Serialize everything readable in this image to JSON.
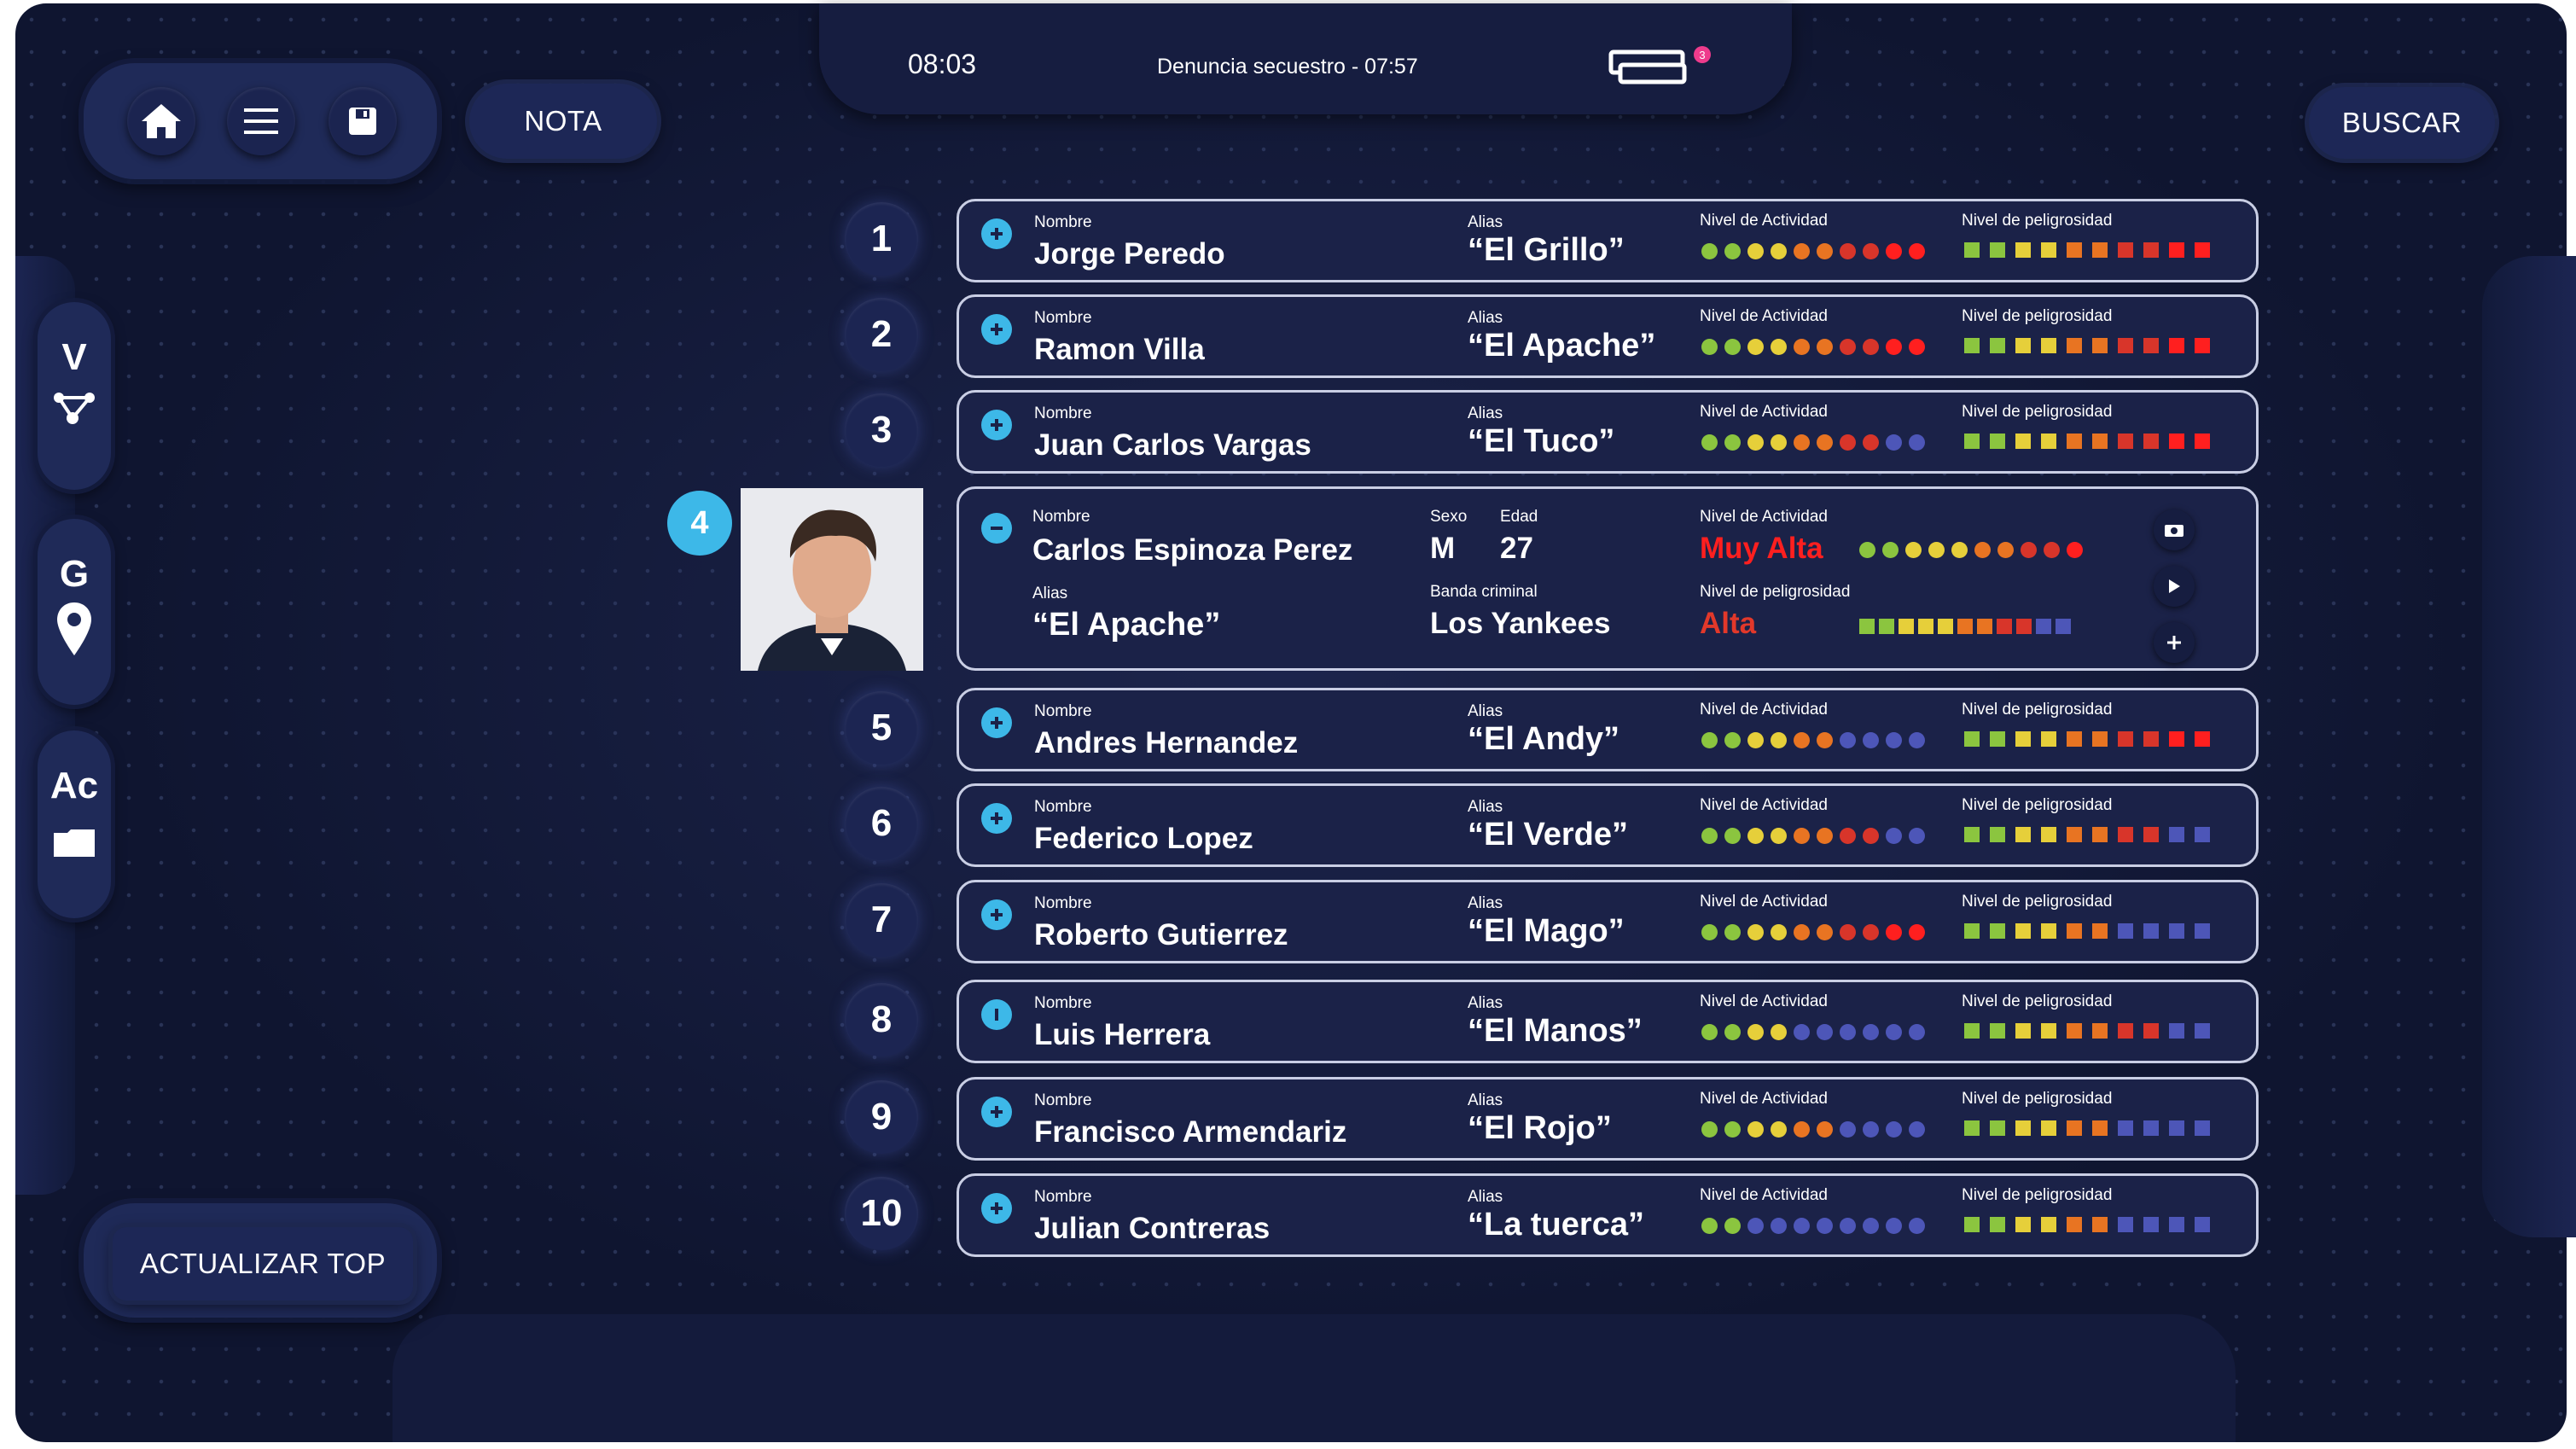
{
  "top": {
    "time": "08:03",
    "title": "Denuncia secuestro  -  07:57",
    "notifications": "3"
  },
  "toolbar": {
    "nota": "NOTA",
    "buscar": "BUSCAR",
    "actualizar": "ACTUALIZAR TOP"
  },
  "sidebar": [
    {
      "letter": "V",
      "icon": "network-icon"
    },
    {
      "letter": "G",
      "icon": "location-pin-icon"
    },
    {
      "letter": "Ac",
      "icon": "folder-icon"
    }
  ],
  "labels": {
    "nombre": "Nombre",
    "alias": "Alias",
    "actividad": "Nivel de Actividad",
    "peligrosidad": "Nivel de peligrosidad",
    "sexo": "Sexo",
    "edad": "Edad",
    "banda": "Banda criminal"
  },
  "colors": {
    "green": "#8bc53f",
    "yellow": "#e6cf3a",
    "orange": "#e87422",
    "red": "#d8352a",
    "brightred": "#ff1f1f",
    "blue": "#4d56b8",
    "accent": "#3db8e8"
  },
  "rows": [
    {
      "rank": "1",
      "name": "Jorge Peredo",
      "alias": "“El Grillo”",
      "activity": [
        "green",
        "green",
        "yellow",
        "yellow",
        "orange",
        "orange",
        "red",
        "red",
        "brightred",
        "brightred"
      ],
      "danger": [
        "green",
        "green",
        "yellow",
        "yellow",
        "orange",
        "orange",
        "red",
        "red",
        "brightred",
        "brightred"
      ]
    },
    {
      "rank": "2",
      "name": "Ramon Villa",
      "alias": "“El Apache”",
      "activity": [
        "green",
        "green",
        "yellow",
        "yellow",
        "orange",
        "orange",
        "red",
        "red",
        "brightred",
        "brightred"
      ],
      "danger": [
        "green",
        "green",
        "yellow",
        "yellow",
        "orange",
        "orange",
        "red",
        "red",
        "brightred",
        "brightred"
      ]
    },
    {
      "rank": "3",
      "name": "Juan Carlos Vargas",
      "alias": "“El Tuco”",
      "activity": [
        "green",
        "green",
        "yellow",
        "yellow",
        "orange",
        "orange",
        "red",
        "red",
        "blue",
        "blue"
      ],
      "danger": [
        "green",
        "green",
        "yellow",
        "yellow",
        "orange",
        "orange",
        "red",
        "red",
        "brightred",
        "brightred"
      ]
    },
    {
      "rank": "5",
      "name": "Andres Hernandez",
      "alias": "“El Andy”",
      "activity": [
        "green",
        "green",
        "yellow",
        "yellow",
        "orange",
        "orange",
        "blue",
        "blue",
        "blue",
        "blue"
      ],
      "danger": [
        "green",
        "green",
        "yellow",
        "yellow",
        "orange",
        "orange",
        "red",
        "red",
        "brightred",
        "brightred"
      ]
    },
    {
      "rank": "6",
      "name": "Federico Lopez",
      "alias": "“El Verde”",
      "activity": [
        "green",
        "green",
        "yellow",
        "yellow",
        "orange",
        "orange",
        "red",
        "red",
        "blue",
        "blue"
      ],
      "danger": [
        "green",
        "green",
        "yellow",
        "yellow",
        "orange",
        "orange",
        "red",
        "red",
        "blue",
        "blue"
      ]
    },
    {
      "rank": "7",
      "name": "Roberto Gutierrez",
      "alias": "“El Mago”",
      "activity": [
        "green",
        "green",
        "yellow",
        "yellow",
        "orange",
        "orange",
        "red",
        "red",
        "brightred",
        "brightred"
      ],
      "danger": [
        "green",
        "green",
        "yellow",
        "yellow",
        "orange",
        "orange",
        "blue",
        "blue",
        "blue",
        "blue"
      ]
    },
    {
      "rank": "8",
      "name": "Luis Herrera",
      "alias": "“El Manos”",
      "activity": [
        "green",
        "green",
        "yellow",
        "yellow",
        "blue",
        "blue",
        "blue",
        "blue",
        "blue",
        "blue"
      ],
      "danger": [
        "green",
        "green",
        "yellow",
        "yellow",
        "orange",
        "orange",
        "red",
        "red",
        "blue",
        "blue"
      ]
    },
    {
      "rank": "9",
      "name": "Francisco Armendariz",
      "alias": "“El Rojo”",
      "activity": [
        "green",
        "green",
        "yellow",
        "yellow",
        "orange",
        "orange",
        "blue",
        "blue",
        "blue",
        "blue"
      ],
      "danger": [
        "green",
        "green",
        "yellow",
        "yellow",
        "orange",
        "orange",
        "blue",
        "blue",
        "blue",
        "blue"
      ]
    },
    {
      "rank": "10",
      "name": "Julian Contreras",
      "alias": "“La tuerca”",
      "activity": [
        "green",
        "green",
        "blue",
        "blue",
        "blue",
        "blue",
        "blue",
        "blue",
        "blue",
        "blue"
      ],
      "danger": [
        "green",
        "green",
        "yellow",
        "yellow",
        "orange",
        "orange",
        "blue",
        "blue",
        "blue",
        "blue"
      ]
    }
  ],
  "selected": {
    "rank": "4",
    "name": "Carlos Espinoza Perez",
    "alias": "“El Apache”",
    "sexo": "M",
    "edad": "27",
    "banda": "Los Yankees",
    "activity_text": "Muy Alta",
    "danger_text": "Alta",
    "activity": [
      "green",
      "green",
      "yellow",
      "yellow",
      "yellow",
      "orange",
      "orange",
      "red",
      "red",
      "brightred"
    ],
    "danger": [
      "green",
      "green",
      "yellow",
      "yellow",
      "yellow",
      "orange",
      "orange",
      "red",
      "red",
      "blue",
      "blue"
    ]
  }
}
